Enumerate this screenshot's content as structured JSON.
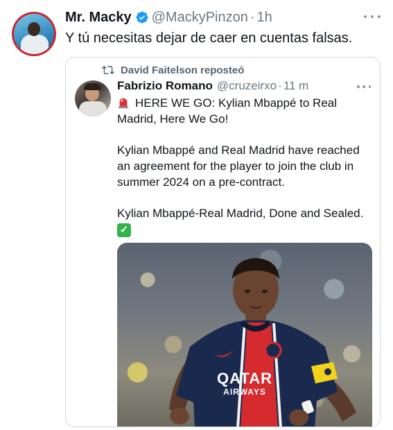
{
  "tweet": {
    "display_name": "Mr. Macky",
    "handle": "@MackyPinzon",
    "time": "1h",
    "text": "Y tú necesitas dejar de caer en cuentas falsas."
  },
  "quote": {
    "reposted_by": "David Faitelson reposteó",
    "display_name": "Fabrizio Romano",
    "handle": "@cruzeirxo",
    "time": "11 m",
    "line1": "HERE WE GO: Kylian Mbappé to Real",
    "line2": "Madrid, Here We Go!",
    "para2_line1": "Kylian Mbappé and Real Madrid have reached",
    "para2_line2": "an agreement for the player to join the club in",
    "para2_line3": "summer 2024 on a pre-contract.",
    "para3": "Kylian Mbappé-Real Madrid, Done and Sealed.",
    "check_emoji": "✓",
    "shirt_sponsor_line1": "QATAR",
    "shirt_sponsor_line2": "AIRWAYS"
  },
  "colors": {
    "verified": "#1d9bf0",
    "secondary_text": "#6b7780",
    "border": "#cfd9de",
    "psg_navy": "#1a2a4f",
    "psg_red": "#d52b2e",
    "captain_band": "#f2d21b"
  },
  "icons": [
    "verified-badge-icon",
    "more-icon",
    "repost-icon",
    "siren-emoji-icon",
    "check-mark-emoji-icon"
  ]
}
